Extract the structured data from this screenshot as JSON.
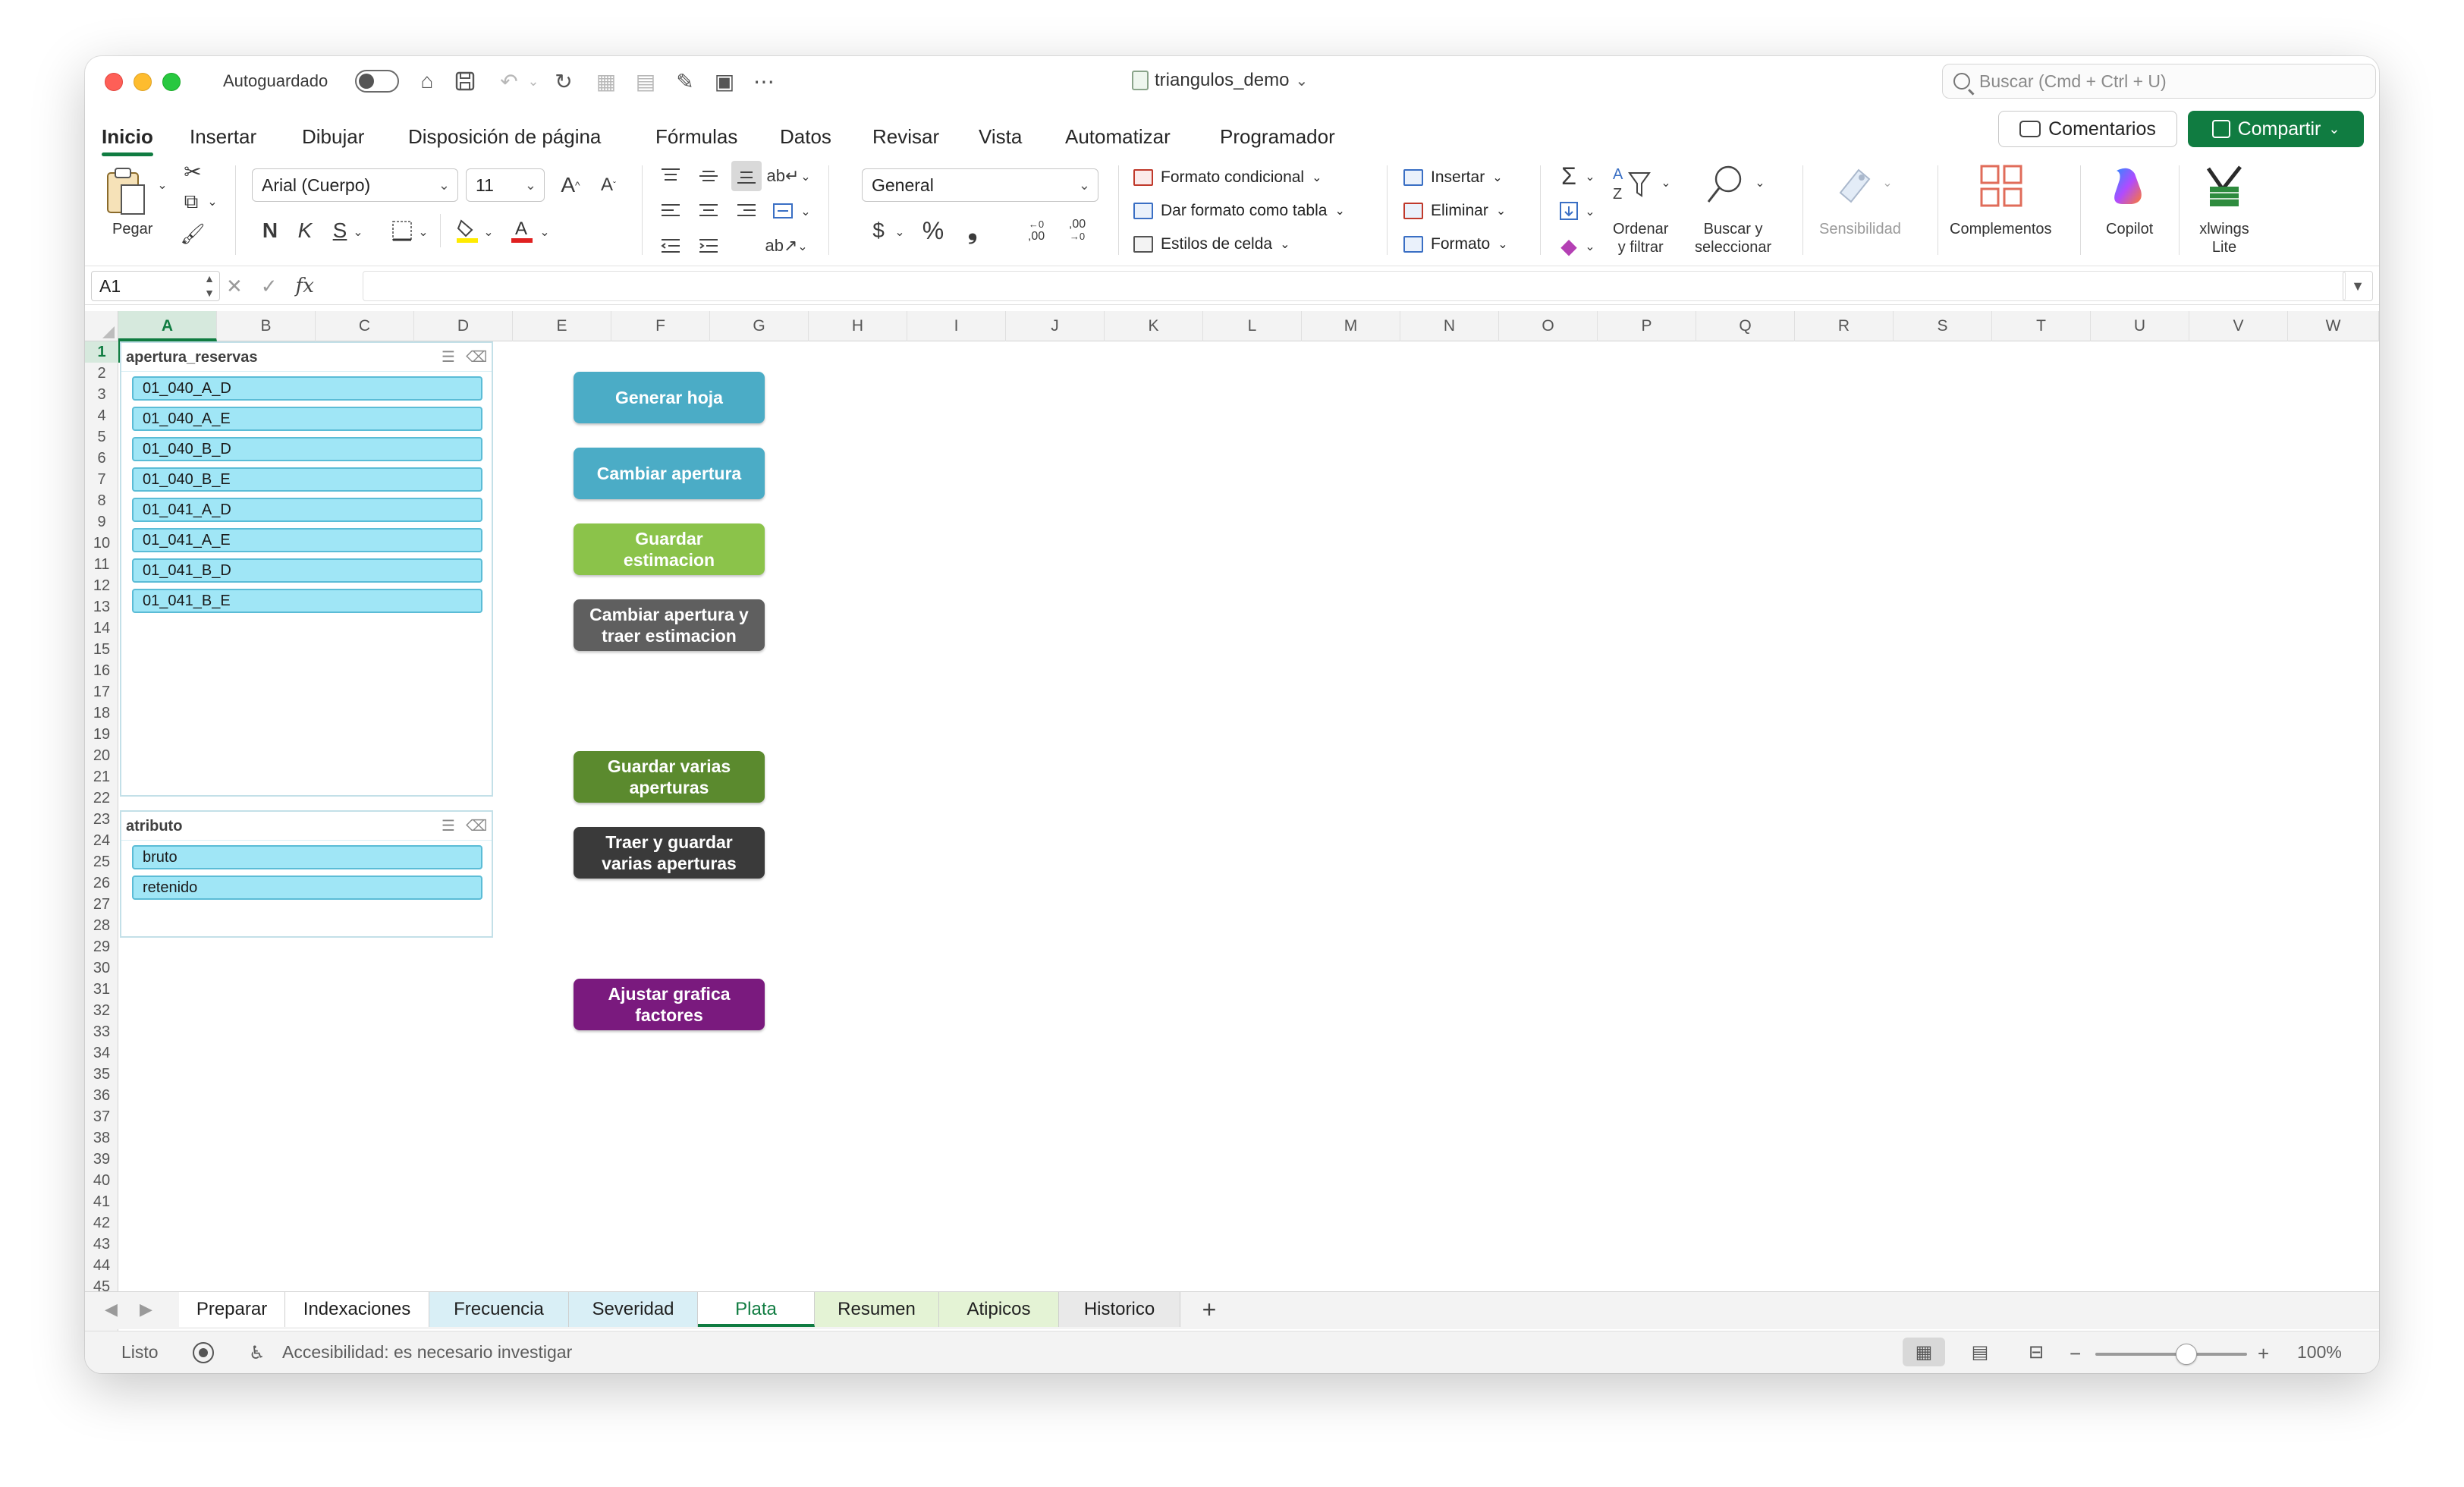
{
  "window": {
    "autosave_label": "Autoguardado",
    "doc_title": "triangulos_demo",
    "doc_title_caret": "⌄",
    "search_placeholder": "Buscar (Cmd + Ctrl + U)"
  },
  "ribbon_tabs": [
    "Inicio",
    "Insertar",
    "Dibujar",
    "Disposición de página",
    "Fórmulas",
    "Datos",
    "Revisar",
    "Vista",
    "Automatizar",
    "Programador"
  ],
  "actions": {
    "comments": "Comentarios",
    "share": "Compartir"
  },
  "ribbon": {
    "paste": "Pegar",
    "font_name": "Arial (Cuerpo)",
    "font_size": "11",
    "bold": "N",
    "italic": "K",
    "underline": "S",
    "number_format": "General",
    "currency": "$",
    "percent": "%",
    "thousands": "❟",
    "inc_decimal": ",00",
    "dec_decimal": ",00",
    "conditional_format": "Formato condicional",
    "format_as_table": "Dar formato como tabla",
    "cell_styles": "Estilos de celda",
    "insert": "Insertar",
    "delete": "Eliminar",
    "format": "Formato",
    "sort_filter_1": "Ordenar",
    "sort_filter_2": "y filtrar",
    "find_select_1": "Buscar y",
    "find_select_2": "seleccionar",
    "sensitivity": "Sensibilidad",
    "addins": "Complementos",
    "copilot": "Copilot",
    "xlwings_1": "xlwings",
    "xlwings_2": "Lite"
  },
  "formula_bar": {
    "name_box": "A1",
    "fx": "fx",
    "formula": ""
  },
  "columns": [
    "A",
    "B",
    "C",
    "D",
    "E",
    "F",
    "G",
    "H",
    "I",
    "J",
    "K",
    "L",
    "M",
    "N",
    "O",
    "P",
    "Q",
    "R",
    "S",
    "T",
    "U",
    "V",
    "W"
  ],
  "rows": [
    "1",
    "2",
    "3",
    "4",
    "5",
    "6",
    "7",
    "8",
    "9",
    "10",
    "11",
    "12",
    "13",
    "14",
    "15",
    "16",
    "17",
    "18",
    "19",
    "20",
    "21",
    "22",
    "23",
    "24",
    "25",
    "26",
    "27",
    "28",
    "29",
    "30",
    "31",
    "32",
    "33",
    "34",
    "35",
    "36",
    "37",
    "38",
    "39",
    "40",
    "41",
    "42",
    "43",
    "44",
    "45"
  ],
  "slicers": [
    {
      "title": "apertura_reservas",
      "items": [
        "01_040_A_D",
        "01_040_A_E",
        "01_040_B_D",
        "01_040_B_E",
        "01_041_A_D",
        "01_041_A_E",
        "01_041_B_D",
        "01_041_B_E"
      ]
    },
    {
      "title": "atributo",
      "items": [
        "bruto",
        "retenido"
      ]
    }
  ],
  "macro_buttons": [
    {
      "label": "Generar hoja",
      "color": "#4bacc6"
    },
    {
      "label": "Cambiar apertura",
      "color": "#4bacc6"
    },
    {
      "label": "Guardar estimacion",
      "color": "#8bc34a"
    },
    {
      "label": "Cambiar apertura y traer estimacion",
      "color": "#5f5f5f"
    },
    {
      "label": "Guardar varias aperturas",
      "color": "#5b8a2e"
    },
    {
      "label": "Traer y guardar varias aperturas",
      "color": "#3a3a3a"
    },
    {
      "label": "Ajustar grafica factores",
      "color": "#7a1a7e"
    }
  ],
  "sheet_tabs": [
    {
      "label": "Preparar",
      "color": "#ffffff"
    },
    {
      "label": "Indexaciones",
      "color": "#ffffff"
    },
    {
      "label": "Frecuencia",
      "color": "#d9eff6"
    },
    {
      "label": "Severidad",
      "color": "#d9eff6"
    },
    {
      "label": "Plata",
      "color": "#ffffff",
      "active": true
    },
    {
      "label": "Resumen",
      "color": "#e4f3d5"
    },
    {
      "label": "Atipicos",
      "color": "#e4f3d5"
    },
    {
      "label": "Historico",
      "color": "#e9e9e9"
    }
  ],
  "status": {
    "ready": "Listo",
    "accessibility": "Accesibilidad: es necesario investigar",
    "zoom": "100%",
    "zoom_minus": "−",
    "zoom_plus": "+"
  }
}
